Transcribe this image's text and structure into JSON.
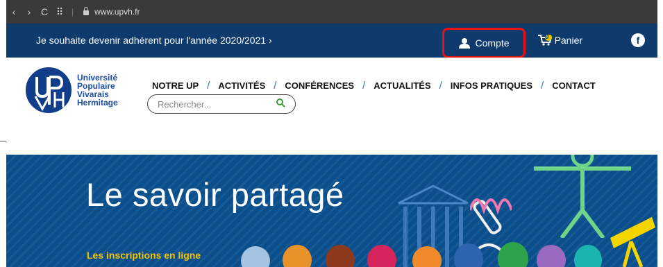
{
  "browser": {
    "url": "www.upvh.fr"
  },
  "topbar": {
    "promo": "Je souhaite devenir adhérent pour l'année 2020/2021 ›",
    "account_label": "Compte",
    "cart_label": "Panier",
    "cart_count": "0",
    "facebook_label": "f"
  },
  "logo": {
    "line1": "Université",
    "line2": "Populaire",
    "line3": "Vivarais",
    "line4": "Hermitage",
    "mark": "UPVH"
  },
  "nav": {
    "items": [
      "NOTRE UP",
      "ACTIVITÉS",
      "CONFÉRENCES",
      "ACTUALITÉS",
      "INFOS PRATIQUES",
      "CONTACT"
    ],
    "separator": "/"
  },
  "search": {
    "placeholder": "Rechercher..."
  },
  "hero": {
    "title": "Le savoir partagé",
    "subtitle": "Les inscriptions en ligne"
  },
  "colors": {
    "topbar": "#0e3a6c",
    "hero": "#0a4f8c",
    "accent": "#f5c400",
    "highlight": "#e11111"
  }
}
